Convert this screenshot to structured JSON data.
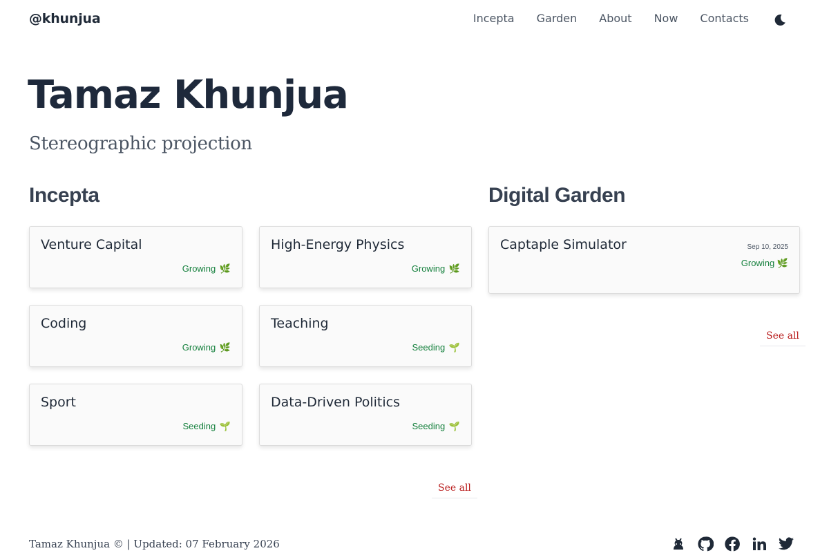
{
  "header": {
    "brand": "@khunjua",
    "nav": [
      "Incepta",
      "Garden",
      "About",
      "Now",
      "Contacts"
    ],
    "theme_icon": "moon-icon"
  },
  "hero": {
    "title": "Tamaz Khunjua",
    "subtitle": "Stereographic projection"
  },
  "incepta": {
    "heading": "Incepta",
    "cards": [
      {
        "title": "Venture Capital",
        "status": "Growing",
        "icon": "🌿"
      },
      {
        "title": "High-Energy Physics",
        "status": "Growing",
        "icon": "🌿"
      },
      {
        "title": "Coding",
        "status": "Growing",
        "icon": "🌿"
      },
      {
        "title": "Teaching",
        "status": "Seeding",
        "icon": "🌱"
      },
      {
        "title": "Sport",
        "status": "Seeding",
        "icon": "🌱"
      },
      {
        "title": "Data-Driven Politics",
        "status": "Seeding",
        "icon": "🌱"
      }
    ],
    "see_all": "See all"
  },
  "garden": {
    "heading": "Digital Garden",
    "cards": [
      {
        "title": "Captaple Simulator",
        "date": "Sep 10, 2025",
        "status": "Growing",
        "icon": "🌿"
      }
    ],
    "see_all": "See all"
  },
  "footer": {
    "text": "Tamaz Khunjua © | Updated: 07 February 2026",
    "social_icons": [
      "mastodon-icon",
      "github-icon",
      "facebook-icon",
      "linkedin-icon",
      "twitter-icon"
    ]
  },
  "colors": {
    "status_green": "#15803d",
    "link_red": "#b91c1c",
    "heading_dark": "#1e293b"
  }
}
